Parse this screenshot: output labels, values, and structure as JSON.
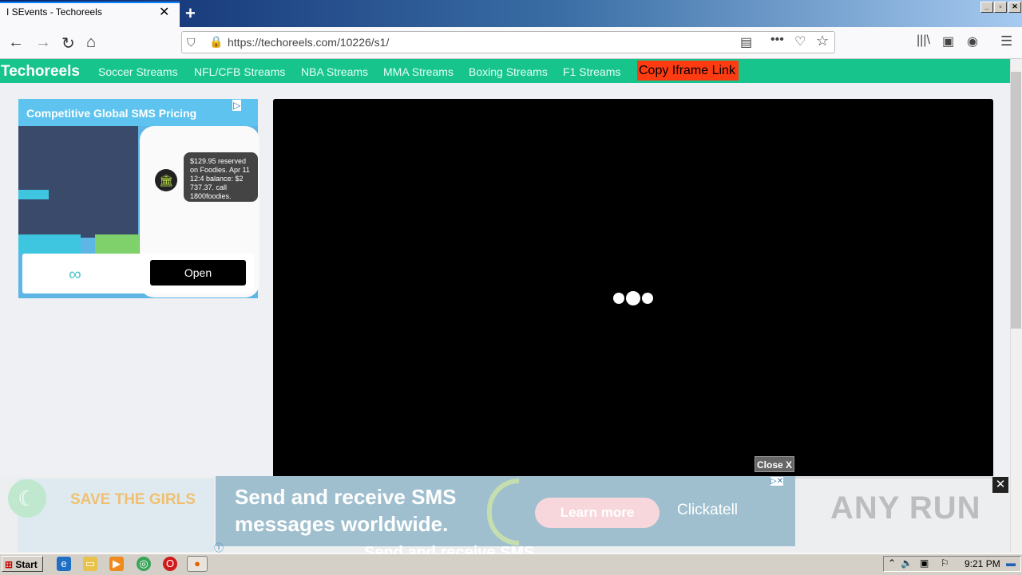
{
  "browser": {
    "tab_title": "I SEvents - Techoreels",
    "tab_close": "✕",
    "new_tab": "+",
    "url": "https://techoreels.com/10226/s1/",
    "window_buttons": [
      "_",
      "▫",
      "✕"
    ]
  },
  "site": {
    "brand": "Techoreels",
    "nav": [
      "Soccer Streams",
      "NFL/CFB Streams",
      "NBA Streams",
      "MMA Streams",
      "Boxing Streams",
      "F1 Streams"
    ],
    "copy_button": "Copy Iframe Link",
    "accent_color": "#17c48c"
  },
  "ad_left": {
    "title": "Competitive Global SMS Pricing",
    "bubble": "$129.95 reserved on Foodies. Apr 11 12:4 balance: $2 737.37. call 1800foodies.",
    "open_button": "Open"
  },
  "player": {
    "close_button": "Close X"
  },
  "banner": {
    "girls_text": "SAVE THE GIRLS",
    "sms_line1": "Send and receive SMS",
    "sms_line2": "messages worldwide.",
    "learn_more": "Learn more",
    "brand": "Clickatell",
    "close": "✕",
    "info": "ⓘ",
    "under_text": "Send and receive SMS"
  },
  "watermark": "ANY RUN",
  "taskbar": {
    "start": "Start",
    "clock": "9:21 PM"
  }
}
